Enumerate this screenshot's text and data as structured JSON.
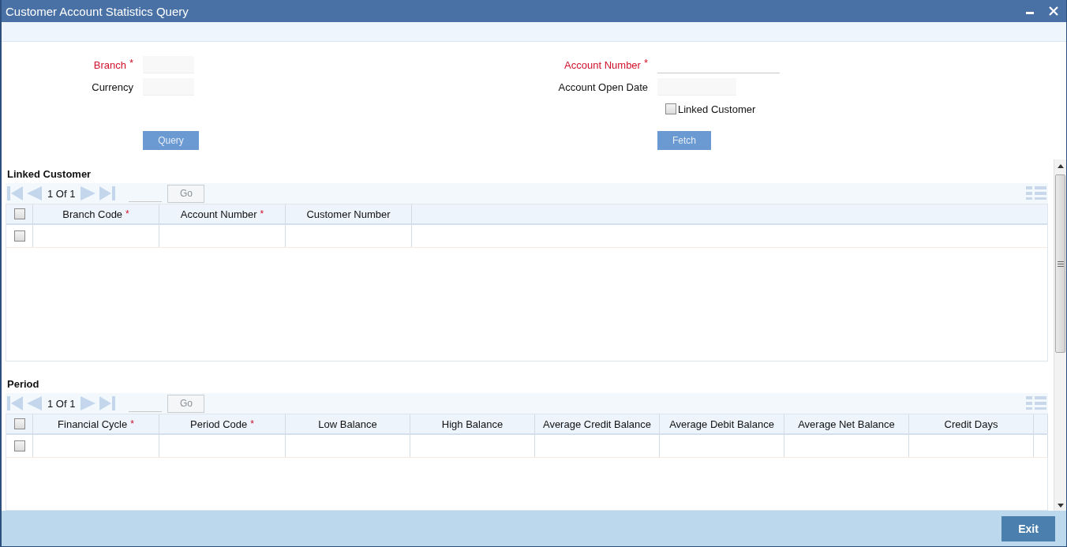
{
  "window": {
    "title": "Customer Account Statistics Query"
  },
  "form": {
    "left": {
      "fields": [
        {
          "label": "Branch",
          "required_mark": "*",
          "kind": "box"
        },
        {
          "label": "Currency",
          "kind": "box"
        }
      ],
      "button": "Query"
    },
    "right": {
      "fields": [
        {
          "label": "Account Number",
          "required_mark": "*",
          "kind": "underline"
        },
        {
          "label": "Account Open Date",
          "kind": "wide-box"
        }
      ],
      "checkbox": {
        "label": "Linked Customer",
        "checked": false
      },
      "button": "Fetch"
    }
  },
  "sections": [
    {
      "title": "Linked Customer",
      "pager": {
        "page_text": "1 Of 1",
        "go": {
          "label": "Go",
          "disabled": true
        }
      },
      "header_checked": false,
      "columns": [
        {
          "label": "Branch Code",
          "required_mark": "*"
        },
        {
          "label": "Account Number",
          "required_mark": "*"
        },
        {
          "label": "Customer Number"
        }
      ],
      "rows": [
        {
          "checked": false
        }
      ]
    },
    {
      "title": "Period",
      "pager": {
        "page_text": "1 Of 1",
        "go": {
          "label": "Go",
          "disabled": true
        }
      },
      "header_checked": false,
      "columns": [
        {
          "label": "Financial Cycle",
          "required_mark": "*"
        },
        {
          "label": "Period Code",
          "required_mark": "*"
        },
        {
          "label": "Low Balance"
        },
        {
          "label": "High Balance"
        },
        {
          "label": "Average Credit Balance"
        },
        {
          "label": "Average Debit Balance"
        },
        {
          "label": "Average Net Balance"
        },
        {
          "label": "Credit Days"
        }
      ],
      "rows": [
        {
          "checked": false
        }
      ]
    }
  ],
  "footer": {
    "button": "Exit"
  }
}
